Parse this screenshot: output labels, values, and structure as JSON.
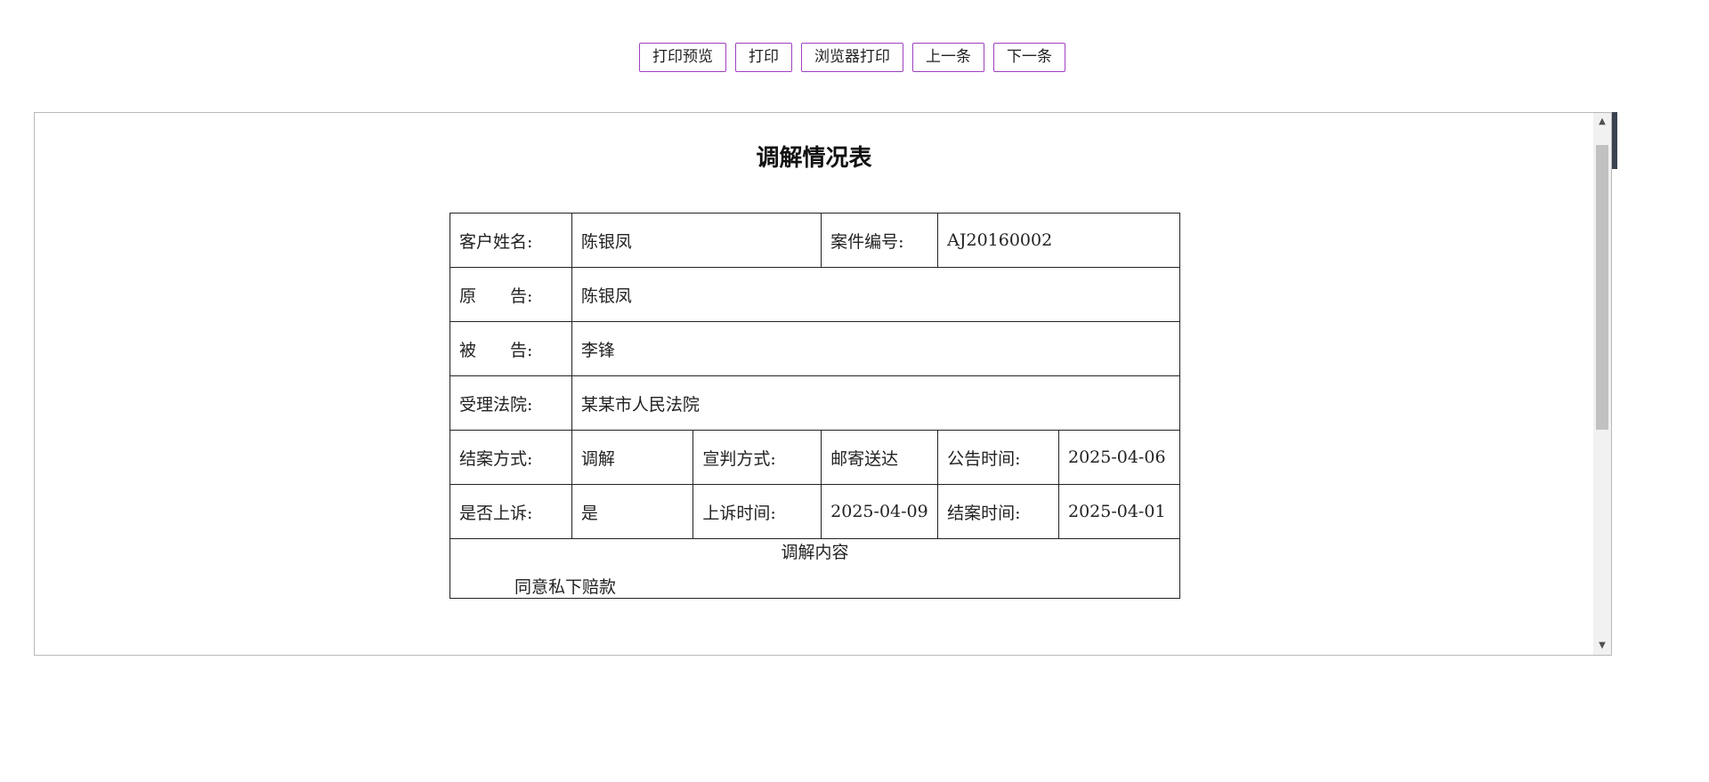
{
  "toolbar": {
    "print_preview": "打印预览",
    "print": "打印",
    "browser_print": "浏览器打印",
    "prev": "上一条",
    "next": "下一条"
  },
  "document": {
    "title": "调解情况表",
    "customer_name_label": "客户姓名:",
    "customer_name": "陈银凤",
    "case_no_label": "案件编号:",
    "case_no": "AJ20160002",
    "plaintiff_label": "原　　告:",
    "plaintiff": "陈银凤",
    "defendant_label": "被　　告:",
    "defendant": "李锋",
    "court_label": "受理法院:",
    "court": "某某市人民法院",
    "closing_method_label": "结案方式:",
    "closing_method": "调解",
    "verdict_method_label": "宣判方式:",
    "verdict_method": "邮寄送达",
    "announce_time_label": "公告时间:",
    "announce_time": "2025-04-06",
    "appealed_label": "是否上诉:",
    "appealed": "是",
    "appeal_time_label": "上诉时间:",
    "appeal_time": "2025-04-09",
    "close_time_label": "结案时间:",
    "close_time": "2025-04-01",
    "mediation_title": "调解内容",
    "mediation_text": "同意私下赔款"
  }
}
